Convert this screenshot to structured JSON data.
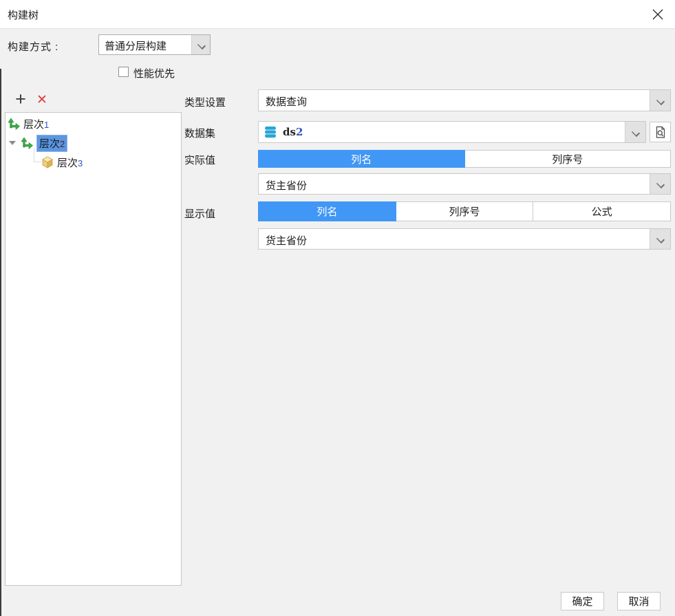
{
  "window": {
    "title": "构建树"
  },
  "build_mode": {
    "label": "构建方式 :",
    "value": "普通分层构建"
  },
  "performance": {
    "label": "性能优先",
    "checked": false
  },
  "tree": {
    "items": [
      {
        "name": "层次",
        "num": "1"
      },
      {
        "name": "层次",
        "num": "2"
      },
      {
        "name": "层次",
        "num": "3"
      }
    ],
    "selected_index": 1
  },
  "form": {
    "type_label": "类型设置",
    "type_value": "数据查询",
    "dataset_label": "数据集",
    "dataset_name": "ds",
    "dataset_num": "2",
    "actual_label": "实际值",
    "actual_tabs": {
      "col_name": "列名",
      "col_index": "列序号"
    },
    "actual_selected_tab": "列名",
    "actual_dropdown": "货主省份",
    "display_label": "显示值",
    "display_tabs": {
      "col_name": "列名",
      "col_index": "列序号",
      "formula": "公式"
    },
    "display_selected_tab": "列名",
    "display_dropdown": "货主省份"
  },
  "footer": {
    "ok": "确定",
    "cancel": "取消"
  },
  "colors": {
    "accent": "#4197f5",
    "tree_selection": "#5d96e0",
    "dataset_icon_blue": "#2aa5d8",
    "tree_branch_green": "#3fae49",
    "tree_cube_gold": "#f2d488",
    "delete_red": "#e23b3b"
  }
}
